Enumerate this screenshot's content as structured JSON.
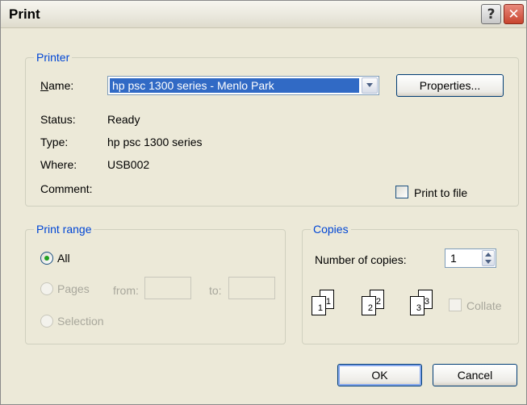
{
  "window": {
    "title": "Print"
  },
  "titlebar": {
    "help_glyph": "?",
    "close_glyph": "✕"
  },
  "printer": {
    "legend": "Printer",
    "name_label": "Name:",
    "name_value": "hp psc 1300 series - Menlo Park",
    "properties_button": "Properties...",
    "status_label": "Status:",
    "status_value": "Ready",
    "type_label": "Type:",
    "type_value": "hp psc 1300 series",
    "where_label": "Where:",
    "where_value": "USB002",
    "comment_label": "Comment:",
    "comment_value": "",
    "print_to_file_label": "Print to file",
    "print_to_file_checked": false
  },
  "print_range": {
    "legend": "Print range",
    "all_label": "All",
    "all_selected": true,
    "pages_label": "Pages",
    "from_label": "from:",
    "from_value": "",
    "to_label": "to:",
    "to_value": "",
    "selection_label": "Selection"
  },
  "copies": {
    "legend": "Copies",
    "number_label": "Number of copies:",
    "number_value": "1",
    "collate_label": "Collate",
    "collate_checked": false,
    "page_numbers": [
      "1",
      "1",
      "2",
      "2",
      "3",
      "3"
    ]
  },
  "footer": {
    "ok_label": "OK",
    "cancel_label": "Cancel"
  },
  "colors": {
    "accent": "#0046d5",
    "selection": "#316ac5",
    "face": "#ece9d8",
    "close_red": "#c8442e"
  }
}
